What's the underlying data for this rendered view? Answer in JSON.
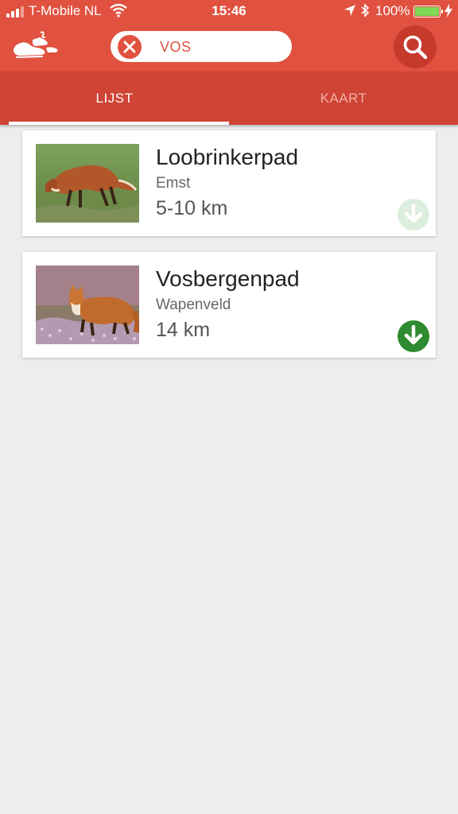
{
  "status_bar": {
    "carrier": "T-Mobile NL",
    "time": "15:46",
    "battery_percent": "100%",
    "battery_level": 1.0,
    "icons": [
      "signal-icon",
      "wifi-icon",
      "location-arrow-icon",
      "bluetooth-icon",
      "battery-icon",
      "charging-bolt-icon"
    ]
  },
  "app_bar": {
    "logo_icon": "walking-shoe-logo",
    "search_query": "VOS",
    "clear_icon": "close-icon",
    "search_icon": "search-icon",
    "colors": {
      "primary": "#e0523f",
      "dark": "#cf4434",
      "button": "#c63a2c"
    }
  },
  "tabs": [
    {
      "label": "LIJST",
      "active": true
    },
    {
      "label": "KAART",
      "active": false
    }
  ],
  "routes": [
    {
      "title": "Loobrinkerpad",
      "place": "Emst",
      "distance": "5-10 km",
      "thumbnail": "fox-on-grass-photo",
      "download_state": "disabled",
      "download_color": "#dceedd"
    },
    {
      "title": "Vosbergenpad",
      "place": "Wapenveld",
      "distance": "14 km",
      "thumbnail": "fox-in-heather-photo",
      "download_state": "enabled",
      "download_color": "#2e8b2f"
    }
  ]
}
